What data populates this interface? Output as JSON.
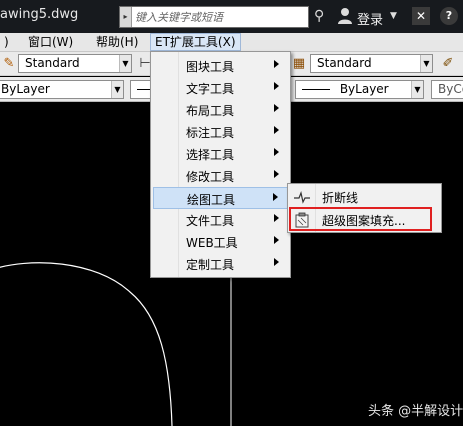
{
  "titlebar": {
    "doc_title": "awing5.dwg",
    "search_placeholder": "键入关键字或短语",
    "login_label": "登录"
  },
  "menubar": {
    "items": [
      {
        "label": "窗口(W)"
      },
      {
        "label": "帮助(H)"
      },
      {
        "label": "ET扩展工具(X)"
      }
    ]
  },
  "toolbar1": {
    "text_style": "Standard",
    "dim_style": "Standard"
  },
  "toolbar2": {
    "layer": "ByLayer",
    "linetype": "ByLayer",
    "color": "ByCo"
  },
  "et_menu": {
    "items": [
      {
        "label": "图块工具",
        "has_submenu": true
      },
      {
        "label": "文字工具",
        "has_submenu": true
      },
      {
        "label": "布局工具",
        "has_submenu": true
      },
      {
        "label": "标注工具",
        "has_submenu": true
      },
      {
        "label": "选择工具",
        "has_submenu": true
      },
      {
        "label": "修改工具",
        "has_submenu": true
      },
      {
        "label": "绘图工具",
        "has_submenu": true,
        "highlighted": true
      },
      {
        "label": "文件工具",
        "has_submenu": true
      },
      {
        "label": "WEB工具",
        "has_submenu": true
      },
      {
        "label": "定制工具",
        "has_submenu": true
      }
    ]
  },
  "draw_submenu": {
    "items": [
      {
        "label": "折断线",
        "icon": "break-line-icon"
      },
      {
        "label": "超级图案填充...",
        "icon": "hatch-icon",
        "outlined": true
      }
    ]
  },
  "watermark": "头条 @半解设计",
  "colors": {
    "canvas": "#000000",
    "menu_bg": "#f1f1f1",
    "menu_highlight": "#cfe2f7",
    "annotation_box": "#e02020"
  }
}
